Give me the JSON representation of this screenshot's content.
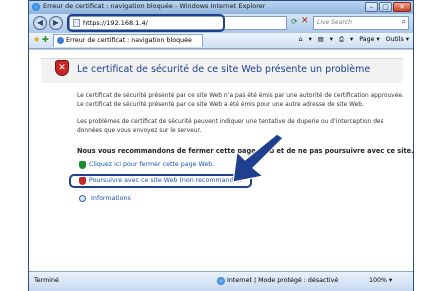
{
  "window": {
    "title": "Erreur de certificat : navigation bloquée - Windows Internet Explorer",
    "buttons": [
      "–",
      "□",
      "✕"
    ]
  },
  "nav": {
    "back": "◀",
    "forward": "▶",
    "url": "https://192.168.1.4/",
    "refresh": "⟳",
    "stop": "✕",
    "search_placeholder": "Live Search",
    "search_icon": "⌕"
  },
  "tabs": {
    "favorites_icon": "★",
    "add_favorites_icon": "✚",
    "active_tab": "Erreur de certificat : navigation bloquée",
    "tools": [
      "⌂",
      "▾",
      "▤",
      "▾",
      "⎙",
      "▾",
      "Page ▾",
      "Outils ▾"
    ]
  },
  "page": {
    "heading": "Le certificat de sécurité de ce site Web présente un problème",
    "para1": [
      "Le certificat de sécurité présenté par ce site Web n’a pas été émis par une autorité de certification approuvée.",
      "Le certificat de sécurité présenté par ce site Web a été émis pour une autre adresse de site Web."
    ],
    "para2": [
      "Les problèmes de certificat de sécurité peuvent indiquer une tentative de duperie ou d’interception des",
      "données que vous envoyez sur le serveur."
    ],
    "recommend": "Nous vous recommandons de fermer cette page Web et de ne pas poursuivre avec ce site.",
    "close_link": "Cliquez ici pour fermer cette page Web.",
    "continue_link": "Poursuivre avec ce site Web (non recommandé).",
    "info_link": "Informations"
  },
  "status": {
    "left": "Terminé",
    "zone": "Internet | Mode protégé : désactivé",
    "zoom": "100%  ▾"
  },
  "colors": {
    "arrow": "#1f3f8f",
    "error_red": "#c62828",
    "link_blue": "#1c55b8"
  }
}
